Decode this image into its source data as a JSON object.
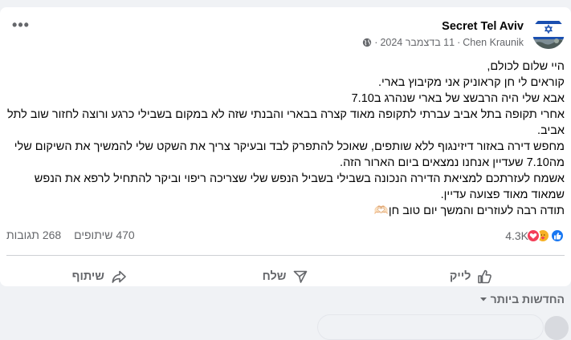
{
  "post": {
    "author": "Secret Tel Aviv",
    "meta": {
      "poster": "Chen Kraunik",
      "dot": "·",
      "date": "11 בדצמבר 2024",
      "visibility_icon": "globe-icon"
    },
    "more_label": "•••",
    "body_lines": [
      "היי שלום לכולם,",
      "קוראים לי חן קראוניק אני מקיבוץ בארי.",
      "אבא שלי היה הרבשצ של בארי שנהרג ב7.10",
      "אחרי תקופה בתל אביב עברתי לתקופה מאוד קצרה בבארי והבנתי שזה לא במקום בשבילי כרגע ורוצה לחזור שוב לתל אביב.",
      "מחפש דירה באזור דיזינגוף ללא שותפים, שאוכל להתפרק לבד ובעיקר צריך את השקט שלי להמשיך את השיקום שלי מה7.10 שעדיין אנחנו נמצאים ביום הארור הזה.",
      "אשמח לעזרתכם למציאת הדירה הנכונה בשבילי בשביל הנפש שלי שצריכה ריפוי וביקר להתחיל לרפא את הנפש שמאוד מאוד פצועה עדיין.",
      "תודה רבה לעוזרים והמשך יום טוב חן🫶🏻"
    ]
  },
  "stats": {
    "reactions_count": "4.3K",
    "reaction_icons": [
      "like-icon",
      "care-icon",
      "love-icon"
    ],
    "comments": "268 תגובות",
    "shares": "470 שיתופים"
  },
  "actions": {
    "like": "לייק",
    "send": "שלח",
    "share": "שיתוף"
  },
  "comments": {
    "sort_label": "החדשות ביותר"
  },
  "colors": {
    "like_blue": "#1877f2",
    "love_red": "#f33e58",
    "care_yellow": "#f7b125",
    "secondary_text": "#65676b"
  }
}
